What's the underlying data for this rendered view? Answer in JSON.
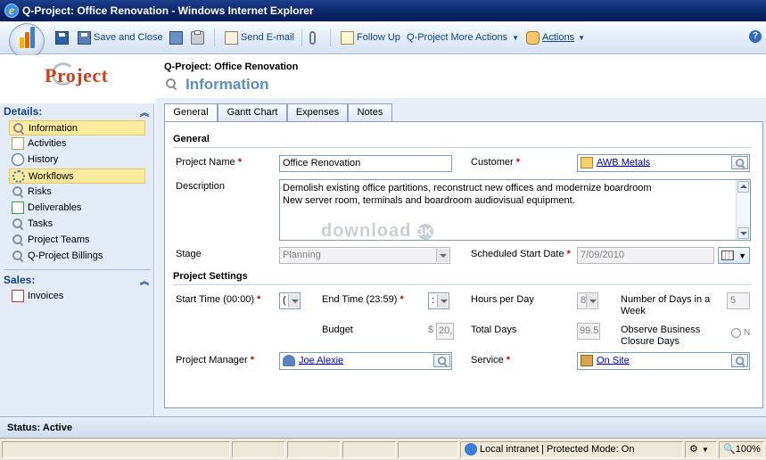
{
  "window": {
    "title": "Q-Project: Office Renovation - Windows Internet Explorer"
  },
  "toolbar": {
    "save_close": "Save and Close",
    "send_email": "Send E-mail",
    "follow_up": "Follow Up",
    "more_actions": "Q-Project More Actions",
    "actions": "Actions",
    "help_icon": "?"
  },
  "logo": {
    "text": "Project"
  },
  "nav": {
    "details_header": "Details:",
    "items": [
      "Information",
      "Activities",
      "History",
      "Workflows",
      "Risks",
      "Deliverables",
      "Tasks",
      "Project Teams",
      "Q-Project Billings"
    ],
    "sales_header": "Sales:",
    "sales_items": [
      "Invoices"
    ]
  },
  "header": {
    "record_title": "Q-Project: Office Renovation",
    "form_title": "Information"
  },
  "tabs": [
    "General",
    "Gantt Chart",
    "Expenses",
    "Notes"
  ],
  "form": {
    "general_section": "General",
    "project_name_label": "Project Name",
    "project_name": "Office Renovation",
    "customer_label": "Customer",
    "customer": "AWB Metals",
    "description_label": "Description",
    "description_line1": "Demolish existing office partitions, reconstruct new offices and modernize boardroom",
    "description_line2": "New server room, terminals and boardroom audiovisual equipment.",
    "stage_label": "Stage",
    "stage": "Planning",
    "sched_start_label": "Scheduled Start Date",
    "sched_start": "7/09/2010",
    "settings_section": "Project Settings",
    "start_time_label": "Start Time (00:00)",
    "start_time": "(",
    "end_time_label": "End Time (23:59)",
    "end_time": ":",
    "hours_label": "Hours per Day",
    "hours": "8",
    "num_days_label_1": "Number of Days in a",
    "num_days_label_2": "Week",
    "num_days": "5",
    "budget_label": "Budget",
    "budget_currency": "$",
    "budget": "20,",
    "total_days_label": "Total Days",
    "total_days": "99.5",
    "closure_label_1": "Observe Business",
    "closure_label_2": "Closure Days",
    "closure_value": "N",
    "pm_label": "Project Manager",
    "pm": "Joe Alexie",
    "service_label": "Service",
    "service": "On Site",
    "required_mark": "*"
  },
  "watermark": {
    "text": "download",
    "mark": "3K"
  },
  "status": {
    "text": "Status: Active"
  },
  "ie_status": {
    "zone": "Local intranet | Protected Mode: On",
    "zoom": "100%"
  }
}
